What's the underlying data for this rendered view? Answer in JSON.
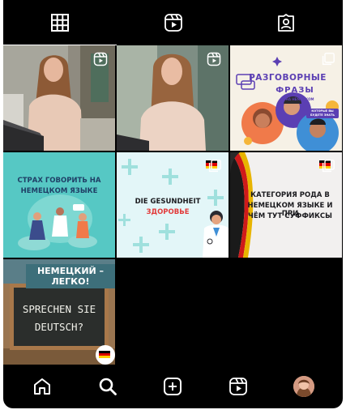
{
  "tabs": [
    {
      "name": "grid-icon",
      "active": true
    },
    {
      "name": "reels-icon",
      "active": false
    },
    {
      "name": "tagged-icon",
      "active": false
    }
  ],
  "posts": {
    "p3": {
      "title": "РАЗГОВОРНЫЕ",
      "subtitle": "ФРАЗЫ",
      "small": "НА НЕМЕЦКОМ",
      "tag": "КОТОРЫЕ ВЫ БУДЕТЕ ЗНАТЬ"
    },
    "p4": {
      "line1": "СТРАХ ГОВОРИТЬ НА",
      "line2": "НЕМЕЦКОМ ЯЗЫКЕ"
    },
    "p5": {
      "line1": "DIE GESUNDHEIT",
      "line2": "ЗДОРОВЬЕ"
    },
    "p6": {
      "line1": "КАТЕГОРИЯ РОДА В",
      "line2": "НЕМЕЦКОМ ЯЗЫКЕ И ПРИ",
      "line3": "ЧЁМ ТУТ СУФФИКСЫ"
    },
    "p7": {
      "banner": "НЕМЕЦКИЙ – ЛЕГКО!",
      "chalk1": "SPRECHEN SIE",
      "chalk2": "DEUTSCH?"
    }
  },
  "bottom_nav": [
    "home-icon",
    "search-icon",
    "create-icon",
    "reels-icon",
    "profile-avatar"
  ],
  "colors": {
    "background": "#000000",
    "teal": "#56c8c4",
    "mint": "#e3f6f8",
    "purple": "#5b3fb3"
  }
}
